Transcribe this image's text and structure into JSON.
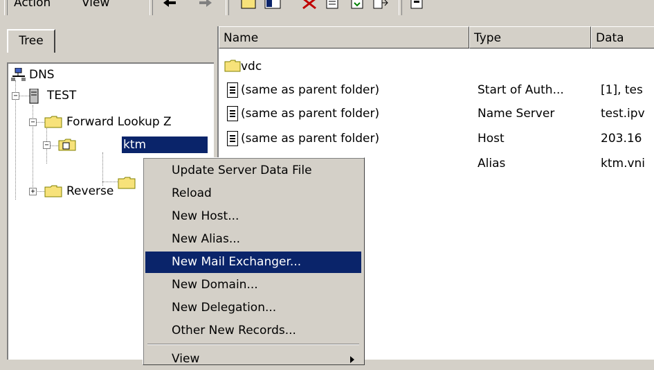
{
  "toolbar": {
    "action_label": "Action",
    "view_label": "View"
  },
  "tree_tab": {
    "label": "Tree"
  },
  "tree": {
    "root": "DNS",
    "server": "TEST",
    "forward_zone": "Forward Lookup Z",
    "selected_zone": "ktm",
    "reverse_zone": "Reverse"
  },
  "list": {
    "columns": [
      "Name",
      "Type",
      "Data"
    ],
    "rows": [
      {
        "name": "vdc",
        "type": "",
        "data": "",
        "icon": "folder-icon"
      },
      {
        "name": "(same as parent folder)",
        "type": "Start of Auth...",
        "data": "[1], tes",
        "icon": "record-icon"
      },
      {
        "name": "(same as parent folder)",
        "type": "Name Server",
        "data": "test.ipv",
        "icon": "record-icon"
      },
      {
        "name": "(same as parent folder)",
        "type": "Host",
        "data": "203.16",
        "icon": "record-icon"
      },
      {
        "name": "",
        "type": "Alias",
        "data": "ktm.vni",
        "icon": "record-icon"
      }
    ]
  },
  "context_menu": {
    "items": [
      "Update Server Data File",
      "Reload",
      "New Host...",
      "New Alias...",
      "New Mail Exchanger...",
      "New Domain...",
      "New Delegation...",
      "Other New Records...",
      "View"
    ],
    "highlighted_index": 4
  },
  "colors": {
    "selection": "#0a246a",
    "face": "#d4d0c8",
    "folder_yellow": "#f7e27a"
  }
}
